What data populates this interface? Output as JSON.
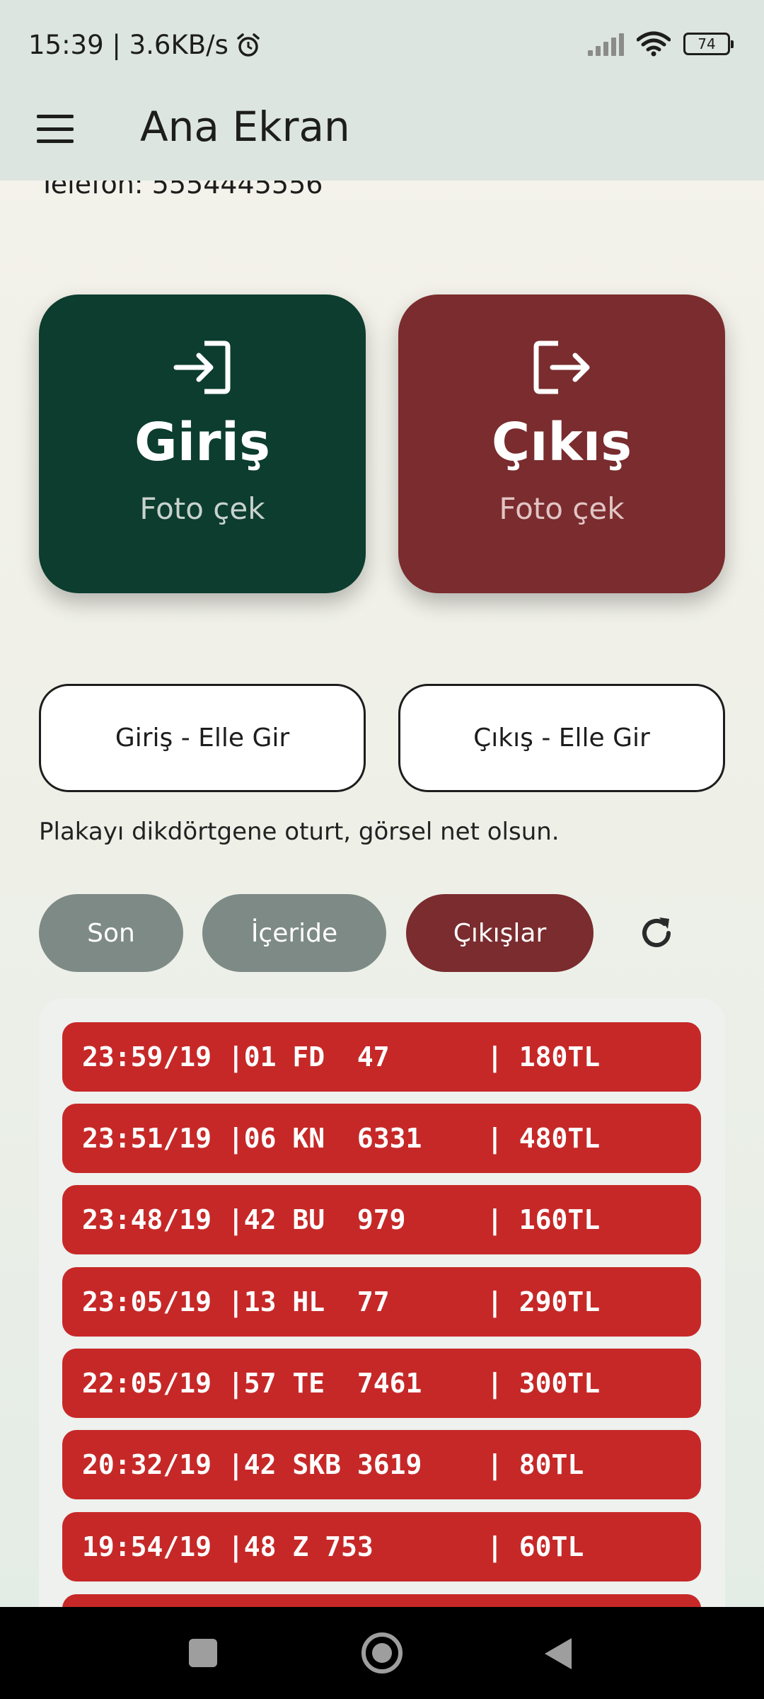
{
  "status_bar": {
    "time_speed": "15:39 | 3.6KB/s",
    "battery": "74"
  },
  "app_bar": {
    "title": "Ana Ekran"
  },
  "header": {
    "phone_text": "Telefon: 5554445556"
  },
  "actions": {
    "entry": {
      "title": "Giriş",
      "subtitle": "Foto çek"
    },
    "exit": {
      "title": "Çıkış",
      "subtitle": "Foto çek"
    },
    "manual_entry": "Giriş - Elle Gir",
    "manual_exit": "Çıkış - Elle Gir"
  },
  "hint": "Plakayı dikdörtgene oturt, görsel net olsun.",
  "filters": {
    "son": "Son",
    "iceride": "İçeride",
    "cikislar": "Çıkışlar",
    "selected": "Çıkışlar"
  },
  "records": [
    {
      "text": "23:59/19 |01 FD  47      | 180TL"
    },
    {
      "text": "23:51/19 |06 KN  6331    | 480TL"
    },
    {
      "text": "23:48/19 |42 BU  979     | 160TL"
    },
    {
      "text": "23:05/19 |13 HL  77      | 290TL"
    },
    {
      "text": "22:05/19 |57 TE  7461    | 300TL"
    },
    {
      "text": "20:32/19 |42 SKB 3619    | 80TL"
    },
    {
      "text": "19:54/19 |48 Z 753       | 60TL"
    }
  ],
  "colors": {
    "entry_card": "#0c3d2f",
    "exit_card": "#7a2c2e",
    "record": "#c62828",
    "chip_inactive": "#7e8a86",
    "chip_active": "#7a2c2e"
  },
  "icons": {
    "entry": "login-icon",
    "exit": "logout-icon",
    "refresh": "refresh-icon",
    "menu": "menu-icon"
  }
}
